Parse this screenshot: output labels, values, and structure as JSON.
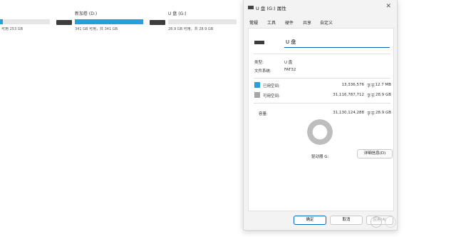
{
  "explorer": {
    "drives": [
      {
        "name": "",
        "size_text": "可用 253 GB",
        "used_fraction": 0.05
      },
      {
        "name": "新加卷 (D:)",
        "size_text": "341 GB 可用，共 341 GB",
        "used_fraction": 1.0
      },
      {
        "name": "U 盘 (G:)",
        "size_text": "28.9 GB 可用，共 28.9 GB",
        "used_fraction": 0.0
      }
    ]
  },
  "dialog": {
    "title": "U 盘 (G:) 属性",
    "close_glyph": "✕",
    "tabs": [
      "常规",
      "工具",
      "硬件",
      "共享",
      "自定义"
    ],
    "name_value": "U 盘",
    "type_label": "类型:",
    "type_value": "U 盘",
    "fs_label": "文件系统:",
    "fs_value": "FAT32",
    "used": {
      "label": "已用空间:",
      "bytes": "13,336,576",
      "unit": "字节",
      "human": "12.7 MB",
      "color": "#26a0da"
    },
    "free": {
      "label": "可用空间:",
      "bytes": "31,116,787,712",
      "unit": "字节",
      "human": "28.9 GB",
      "color": "#a6a6a6"
    },
    "capacity": {
      "label": "容量:",
      "bytes": "31,130,124,288",
      "unit": "字节",
      "human": "28.9 GB"
    },
    "used_fraction": 0.0004,
    "drive_label": "驱动器 G:",
    "detail_button": "详细信息(D)",
    "buttons": {
      "ok": "确定",
      "cancel": "取消",
      "apply": "应用(A)"
    }
  },
  "colors": {
    "accent": "#0067c0",
    "used": "#26a0da",
    "free": "#a6a6a6"
  }
}
